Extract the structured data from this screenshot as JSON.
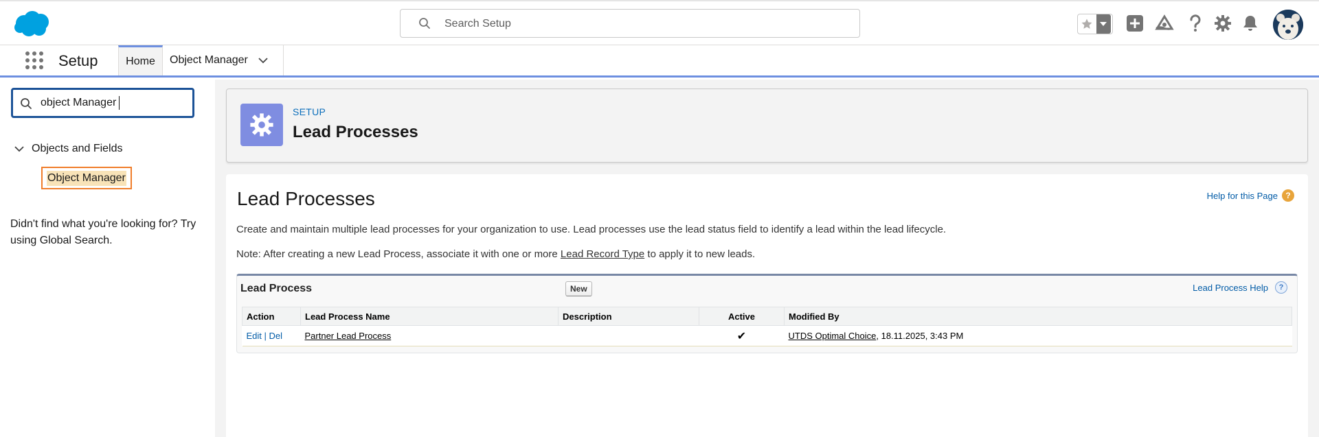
{
  "header": {
    "search_placeholder": "Search Setup",
    "icons": [
      "salesforce-cloud-logo",
      "favorite-star-icon",
      "favorites-dropdown-icon",
      "global-actions-plus-icon",
      "trailhead-icon",
      "help-icon",
      "setup-gear-icon",
      "notifications-bell-icon",
      "user-avatar"
    ]
  },
  "context_bar": {
    "app_name": "Setup",
    "tabs": [
      {
        "label": "Home"
      },
      {
        "label": "Object Manager"
      }
    ]
  },
  "sidebar": {
    "quick_find_value": "object Manager",
    "tree_group": "Objects and Fields",
    "tree_item": "Object Manager",
    "not_found_text": "Didn't find what you're looking for? Try using Global Search."
  },
  "page_header": {
    "eyebrow": "SETUP",
    "title": "Lead Processes"
  },
  "content": {
    "heading": "Lead Processes",
    "help_link": "Help for this Page",
    "description": "Create and maintain multiple lead processes for your organization to use. Lead processes use the lead status field to identify a lead within the lead lifecycle.",
    "note_prefix": "Note: After creating a new Lead Process, associate it with one or more ",
    "note_link": "Lead Record Type",
    "note_suffix": " to apply it to new leads.",
    "list": {
      "title": "Lead Process",
      "new_button": "New",
      "help_link": "Lead Process Help",
      "columns": [
        "Action",
        "Lead Process Name",
        "Description",
        "Active",
        "Modified By"
      ],
      "rows": [
        {
          "edit": "Edit",
          "separator": "|",
          "del": "Del",
          "name": "Partner Lead Process",
          "description": "",
          "active": "✔",
          "modified_by_user": "UTDS Optimal Choice",
          "modified_by_date": ", 18.11.2025, 3:43 PM"
        }
      ]
    }
  },
  "colors": {
    "brand_blue": "#00a1e0",
    "setup_icon_bg": "#7f8de1",
    "link_blue": "#015ba7",
    "highlight_border": "#f07d2a"
  }
}
